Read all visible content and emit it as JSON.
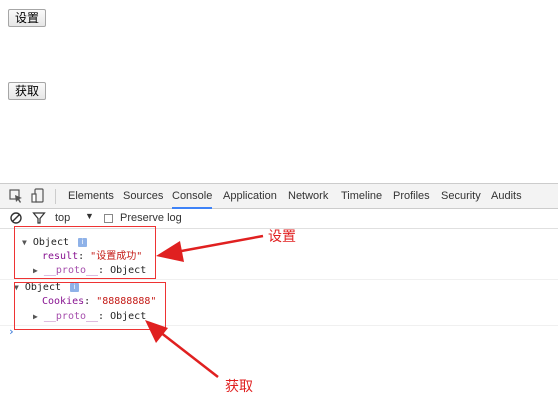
{
  "page": {
    "set_button": "设置",
    "get_button": "获取"
  },
  "devtools": {
    "tabs": [
      "Elements",
      "Sources",
      "Console",
      "Application",
      "Network",
      "Timeline",
      "Profiles",
      "Security",
      "Audits"
    ],
    "active_tab": "Console",
    "filter": {
      "context": "top",
      "preserve_log_label": "Preserve log",
      "preserve_log_checked": false
    },
    "icons": {
      "inspect": "inspect-element-icon",
      "device": "device-mode-icon",
      "clear": "clear-console-icon",
      "filter": "filter-icon"
    }
  },
  "console": {
    "entries": [
      {
        "header": "Object",
        "prop_key": "result",
        "prop_value": "\"设置成功\"",
        "proto_key": "__proto__",
        "proto_value": ": Object"
      },
      {
        "header": "Object",
        "prop_key": "Cookies",
        "prop_value": "\"88888888\"",
        "proto_key": "__proto__",
        "proto_value": ": Object"
      }
    ],
    "prompt": "›"
  },
  "annotations": {
    "set_label": "设置",
    "get_label": "获取",
    "color": "#e02020"
  }
}
